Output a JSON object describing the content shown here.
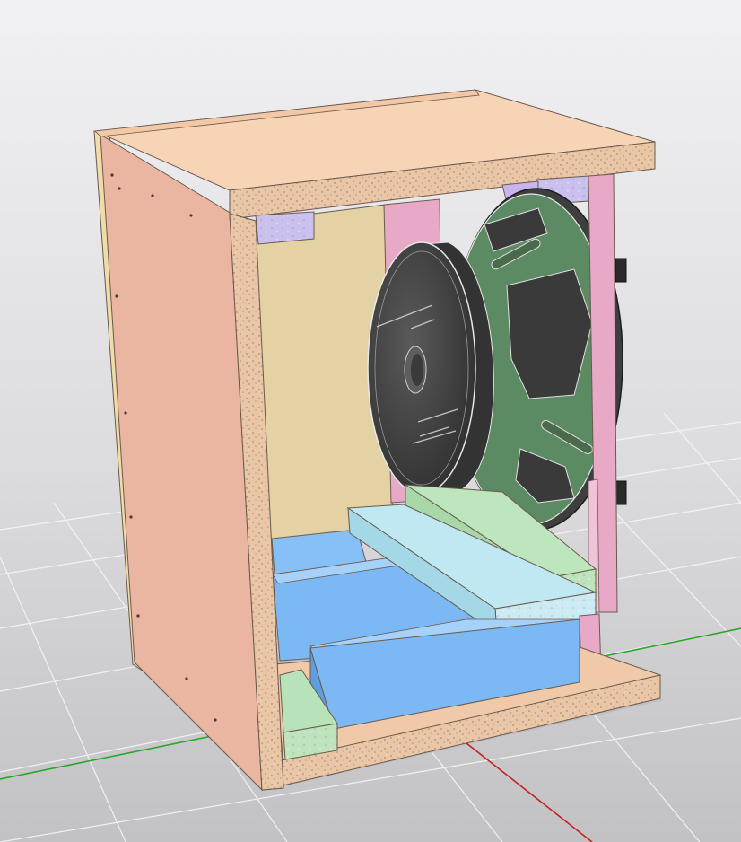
{
  "scene": {
    "background_top": "#ececee",
    "background_bottom": "#c4c4c6",
    "grid_color": "#f4f4f4",
    "axis_x_color": "#2aa52a",
    "axis_y_color": "#c02020"
  },
  "materials": {
    "chipboard_face": "#f7d2b4",
    "chipboard_edge": "#e6c6a8",
    "side_panel": "#e9b7a2",
    "back_panel": "#e4d2a4",
    "front_brace": "#e7a9c6",
    "corner_block": "#c9b5ec",
    "damping_blue": "#7cb8f4",
    "brace_cyan": "#b6e4ef",
    "brace_green": "#b8e2b8",
    "driver_basket": "#5c8a62",
    "driver_magnet": "#4a4a4a"
  },
  "driver": {
    "label_lines": [
      "",
      ""
    ]
  }
}
